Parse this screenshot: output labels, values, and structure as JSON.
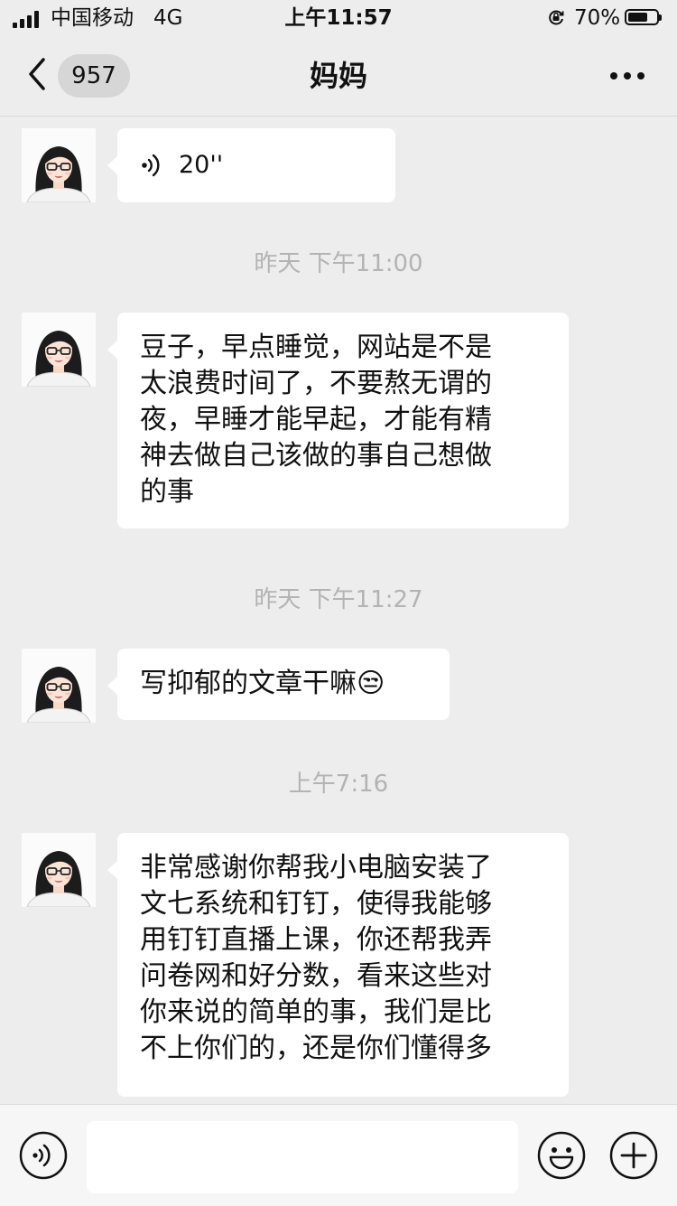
{
  "status_bar": {
    "carrier": "中国移动",
    "network": "4G",
    "time": "上午11:57",
    "battery_percent": "70%",
    "battery_level": 0.7,
    "signal_icon": "signal-icon",
    "rotation_lock_icon": "rotation-lock-icon"
  },
  "nav": {
    "back_icon": "chevron-left-icon",
    "unread_count": "957",
    "title": "妈妈",
    "more_icon": "more-icon"
  },
  "messages": [
    {
      "type": "voice",
      "duration": "20''"
    },
    {
      "type": "timestamp",
      "text": "昨天 下午11:00"
    },
    {
      "type": "text",
      "lines": [
        "豆子，早点睡觉，网站是不是",
        "太浪费时间了，不要熬无谓的",
        "夜，早睡才能早起，才能有精",
        "神去做自己该做的事自己想做",
        "的事"
      ]
    },
    {
      "type": "timestamp",
      "text": "昨天 下午11:27"
    },
    {
      "type": "text",
      "text": "写抑郁的文章干嘛",
      "emoji": "😒"
    },
    {
      "type": "timestamp",
      "text": "上午7:16"
    },
    {
      "type": "text",
      "lines": [
        "非常感谢你帮我小电脑安装了",
        "文七系统和钉钉，使得我能够",
        "用钉钉直播上课，你还帮我弄",
        "问卷网和好分数，看来这些对",
        "你来说的简单的事，我们是比",
        "不上你们的，还是你们懂得多"
      ]
    }
  ],
  "input_bar": {
    "voice_icon": "voice-input-icon",
    "emoji_icon": "emoji-icon",
    "plus_icon": "plus-icon",
    "input_value": ""
  },
  "colors": {
    "background": "#ededed",
    "bubble": "#ffffff",
    "timestamp": "#b3b3b3",
    "input_bar": "#f6f6f6"
  }
}
